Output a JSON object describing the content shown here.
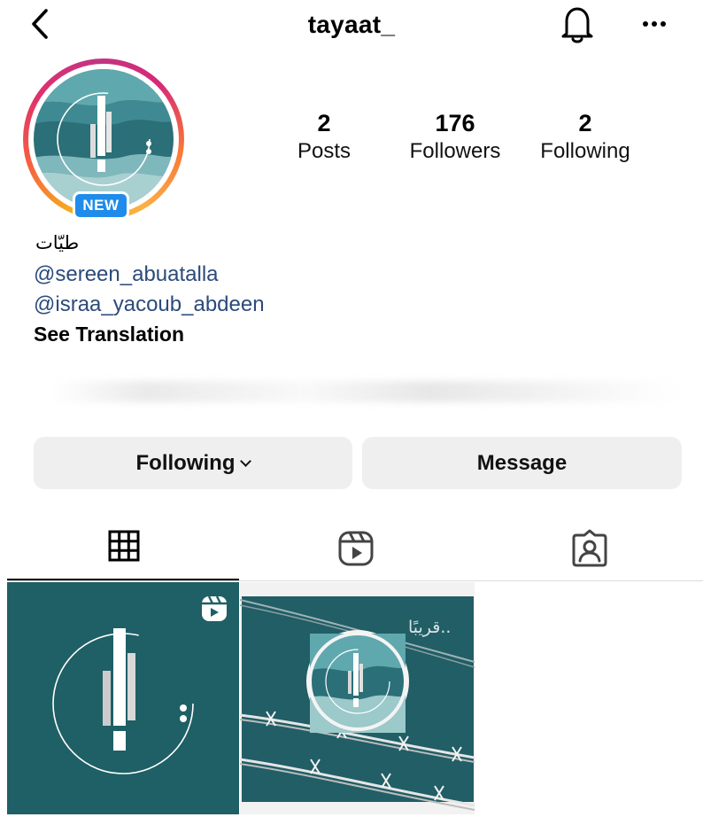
{
  "header": {
    "username": "tayaat_",
    "back_icon": "chevron-left-icon",
    "notifications_icon": "bell-icon",
    "more_icon": "more-horizontal-icon"
  },
  "profile": {
    "avatar_badge": "NEW",
    "stats": [
      {
        "value": "2",
        "label": "Posts"
      },
      {
        "value": "176",
        "label": "Followers"
      },
      {
        "value": "2",
        "label": "Following"
      }
    ]
  },
  "bio": {
    "name": "طيّات",
    "mentions": [
      "@sereen_abuatalla",
      "@israa_yacoub_abdeen"
    ],
    "see_translation": "See Translation"
  },
  "actions": {
    "following_label": "Following",
    "message_label": "Message"
  },
  "tabs": [
    {
      "icon": "grid-icon",
      "active": true
    },
    {
      "icon": "reels-icon",
      "active": false
    },
    {
      "icon": "tagged-icon",
      "active": false
    }
  ],
  "posts": [
    {
      "type": "reel",
      "badge_icon": "reel-badge-icon"
    },
    {
      "type": "image",
      "overlay_text": "قريبًا.."
    }
  ],
  "colors": {
    "teal": "#1f5f66",
    "link": "#2b4a7a",
    "badge": "#1f8ceb",
    "button_bg": "#efefef"
  }
}
